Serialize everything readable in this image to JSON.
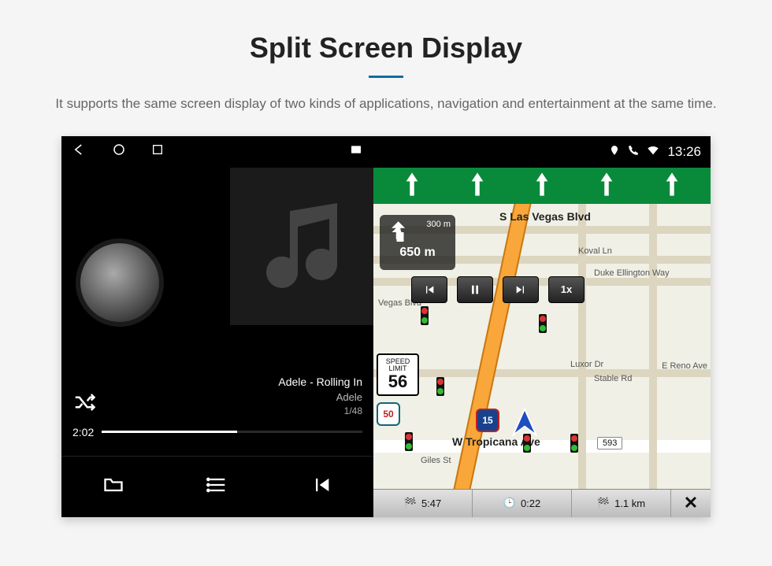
{
  "header": {
    "title": "Split Screen Display",
    "subtitle": "It supports the same screen display of two kinds of applications, navigation and entertainment at the same time."
  },
  "status_right": {
    "time": "13:26"
  },
  "music": {
    "title": "Adele - Rolling In",
    "artist": "Adele",
    "counter": "1/48",
    "elapsed": "2:02"
  },
  "nav": {
    "turn_secondary": "300 m",
    "turn_distance": "650 m",
    "speed_limit_label": "SPEED LIMIT",
    "speed_limit": "56",
    "playback_speed": "1x",
    "streets": {
      "main": "S Las Vegas Blvd",
      "tropicana": "W Tropicana Ave",
      "koval": "Koval Ln",
      "duke": "Duke Ellington Way",
      "vegas_small": "Vegas Blvd",
      "luxor": "Luxor Dr",
      "stable": "Stable Rd",
      "reno": "E Reno Ave",
      "giles": "Giles St"
    },
    "shields": {
      "i15": "15",
      "us50": "50"
    },
    "addr_pin": "593",
    "eta": "5:47",
    "duration": "0:22",
    "remaining": "1.1 km"
  }
}
